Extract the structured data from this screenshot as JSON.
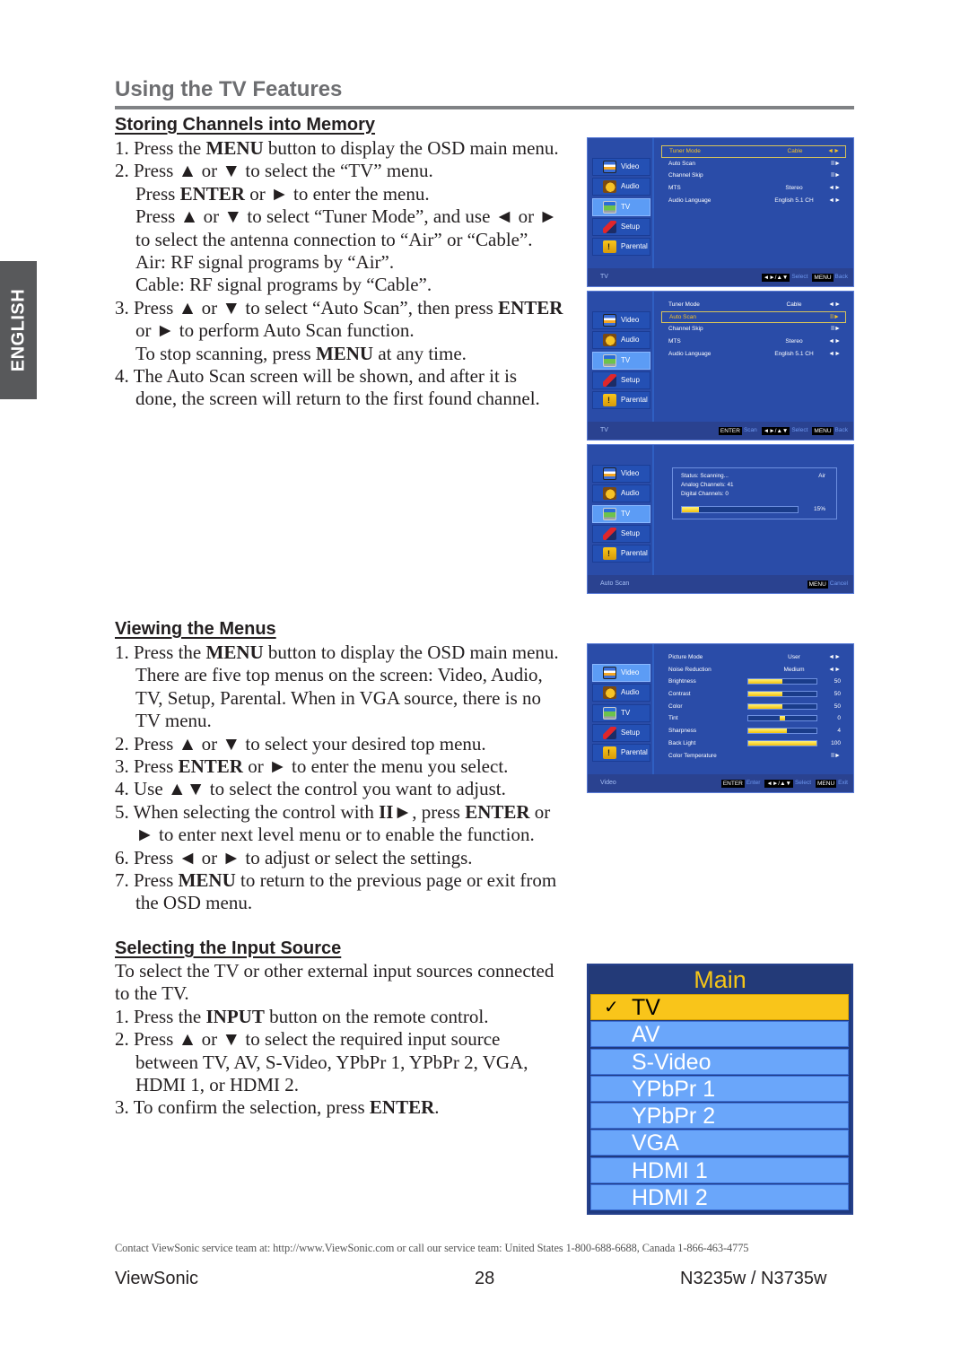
{
  "side_tab": "ENGLISH",
  "page_title": "Using the TV Features",
  "sections": {
    "storing": {
      "heading": "Storing Channels into Memory",
      "lines": [
        {
          "parts": [
            {
              "t": "1. Press the "
            },
            {
              "t": "MENU",
              "b": true
            },
            {
              "t": " button to display the OSD main menu."
            }
          ],
          "indent": false
        },
        {
          "parts": [
            {
              "t": "2. Press ▲ or ▼ to select the “TV” menu."
            }
          ],
          "indent": false
        },
        {
          "parts": [
            {
              "t": "Press "
            },
            {
              "t": "ENTER",
              "b": true
            },
            {
              "t": " or ► to enter the menu."
            }
          ],
          "indent": true
        },
        {
          "parts": [
            {
              "t": "Press ▲ or ▼ to select “Tuner Mode”, and use ◄ or ►"
            }
          ],
          "indent": true
        },
        {
          "parts": [
            {
              "t": "to select the antenna connection to “Air” or “Cable”."
            }
          ],
          "indent": true
        },
        {
          "parts": [
            {
              "t": "Air: RF signal programs by “Air”."
            }
          ],
          "indent": true
        },
        {
          "parts": [
            {
              "t": "Cable: RF signal programs by “Cable”."
            }
          ],
          "indent": true
        },
        {
          "parts": [
            {
              "t": "3. Press ▲ or ▼ to select “Auto Scan”, then press "
            },
            {
              "t": "ENTER",
              "b": true
            }
          ],
          "indent": false
        },
        {
          "parts": [
            {
              "t": "or ► to perform Auto Scan function."
            }
          ],
          "indent": true
        },
        {
          "parts": [
            {
              "t": "To stop scanning, press "
            },
            {
              "t": "MENU",
              "b": true
            },
            {
              "t": " at any time."
            }
          ],
          "indent": true
        },
        {
          "parts": [
            {
              "t": "4. The Auto Scan screen will be shown, and after it is"
            }
          ],
          "indent": false
        },
        {
          "parts": [
            {
              "t": "done, the screen will return to the first found channel."
            }
          ],
          "indent": true
        }
      ]
    },
    "viewing": {
      "heading": "Viewing the Menus",
      "lines": [
        {
          "parts": [
            {
              "t": "1. Press the "
            },
            {
              "t": "MENU",
              "b": true
            },
            {
              "t": " button to display the OSD main menu."
            }
          ],
          "indent": false
        },
        {
          "parts": [
            {
              "t": "There are five top menus on the screen: Video, Audio,"
            }
          ],
          "indent": true
        },
        {
          "parts": [
            {
              "t": "TV, Setup, Parental. When in VGA source, there is no"
            }
          ],
          "indent": true
        },
        {
          "parts": [
            {
              "t": "TV menu."
            }
          ],
          "indent": true
        },
        {
          "parts": [
            {
              "t": "2. Press ▲ or ▼ to select your desired top menu."
            }
          ],
          "indent": false
        },
        {
          "parts": [
            {
              "t": "3. Press "
            },
            {
              "t": "ENTER",
              "b": true
            },
            {
              "t": " or ► to enter the menu you select."
            }
          ],
          "indent": false
        },
        {
          "parts": [
            {
              "t": "4. Use ▲▼ to select the control you want to adjust."
            }
          ],
          "indent": false
        },
        {
          "parts": [
            {
              "t": "5. When selecting the control with "
            },
            {
              "t": "II►",
              "b": true
            },
            {
              "t": ", press "
            },
            {
              "t": "ENTER",
              "b": true
            },
            {
              "t": " or"
            }
          ],
          "indent": false
        },
        {
          "parts": [
            {
              "t": "► to enter next level menu or to enable the function."
            }
          ],
          "indent": true
        },
        {
          "parts": [
            {
              "t": "6. Press ◄ or ► to adjust or select the settings."
            }
          ],
          "indent": false
        },
        {
          "parts": [
            {
              "t": "7. Press "
            },
            {
              "t": "MENU",
              "b": true
            },
            {
              "t": " to return to the previous page or exit from"
            }
          ],
          "indent": false
        },
        {
          "parts": [
            {
              "t": "the OSD menu."
            }
          ],
          "indent": true
        }
      ]
    },
    "input": {
      "heading": "Selecting the Input Source",
      "lines": [
        {
          "parts": [
            {
              "t": "To select the TV or other external input sources connected"
            }
          ],
          "indent": false
        },
        {
          "parts": [
            {
              "t": "to the TV."
            }
          ],
          "indent": false
        },
        {
          "parts": [
            {
              "t": "1. Press the "
            },
            {
              "t": "INPUT",
              "b": true
            },
            {
              "t": " button on the remote control."
            }
          ],
          "indent": false
        },
        {
          "parts": [
            {
              "t": "2. Press ▲ or ▼ to select the required input source"
            }
          ],
          "indent": false
        },
        {
          "parts": [
            {
              "t": "between TV, AV, S-Video, YPbPr 1, YPbPr 2, VGA,"
            }
          ],
          "indent": true
        },
        {
          "parts": [
            {
              "t": "HDMI 1, or HDMI 2."
            }
          ],
          "indent": true
        },
        {
          "parts": [
            {
              "t": "3. To confirm the selection, press "
            },
            {
              "t": "ENTER",
              "b": true
            },
            {
              "t": "."
            }
          ],
          "indent": false
        }
      ]
    }
  },
  "osd_nav": [
    {
      "label": "Video",
      "icon": "video-icon"
    },
    {
      "label": "Audio",
      "icon": "audio-icon"
    },
    {
      "label": "TV",
      "icon": "tv-icon"
    },
    {
      "label": "Setup",
      "icon": "setup-icon"
    },
    {
      "label": "Parental",
      "icon": "parental-icon"
    }
  ],
  "osd_screens": {
    "tuner": {
      "active_nav": "TV",
      "rows": [
        {
          "label": "Tuner Mode",
          "value": "Cable",
          "arrow": "◄►",
          "selected": true
        },
        {
          "label": "Auto Scan",
          "value": "",
          "arrow": "II►",
          "selected": false
        },
        {
          "label": "Channel Skip",
          "value": "",
          "arrow": "II►",
          "selected": false
        },
        {
          "label": "MTS",
          "value": "Stereo",
          "arrow": "◄►",
          "selected": false
        },
        {
          "label": "Audio Language",
          "value": "English 5.1 CH",
          "arrow": "◄►",
          "selected": false
        }
      ],
      "footer_title": "TV",
      "hints": [
        {
          "key": "◄►/▲▼",
          "label": "Select"
        },
        {
          "key": "MENU",
          "label": "Back"
        }
      ]
    },
    "autoscan_select": {
      "active_nav": "TV",
      "rows": [
        {
          "label": "Tuner Mode",
          "value": "Cable",
          "arrow": "◄►",
          "selected": false
        },
        {
          "label": "Auto Scan",
          "value": "",
          "arrow": "II►",
          "selected": true
        },
        {
          "label": "Channel Skip",
          "value": "",
          "arrow": "II►",
          "selected": false
        },
        {
          "label": "MTS",
          "value": "Stereo",
          "arrow": "◄►",
          "selected": false
        },
        {
          "label": "Audio Language",
          "value": "English 5.1 CH",
          "arrow": "◄►",
          "selected": false
        }
      ],
      "footer_title": "TV",
      "hints": [
        {
          "key": "ENTER",
          "label": "Scan"
        },
        {
          "key": "◄►/▲▼",
          "label": "Select"
        },
        {
          "key": "MENU",
          "label": "Back"
        }
      ]
    },
    "scanning": {
      "active_nav": "TV",
      "status": "Status: Scanning...",
      "mode": "Air",
      "analog": "Analog Channels: 41",
      "digital": "Digital Channels: 0",
      "progress_percent": 15,
      "progress_label": "15%",
      "footer_title": "Auto Scan",
      "hints": [
        {
          "key": "MENU",
          "label": "Cancel"
        }
      ]
    },
    "video": {
      "active_nav": "Video",
      "rows": [
        {
          "label": "Picture Mode",
          "value": "User",
          "arrow": "◄►"
        },
        {
          "label": "Noise Reduction",
          "value": "Medium",
          "arrow": "◄►"
        },
        {
          "label": "Brightness",
          "slider": 50,
          "num": "50"
        },
        {
          "label": "Contrast",
          "slider": 50,
          "num": "50"
        },
        {
          "label": "Color",
          "slider": 50,
          "num": "50"
        },
        {
          "label": "Tint",
          "tint": 0,
          "num": "0"
        },
        {
          "label": "Sharpness",
          "slider": 56,
          "num": "4"
        },
        {
          "label": "Back Light",
          "slider": 100,
          "num": "100"
        },
        {
          "label": "Color Temperature",
          "value": "",
          "arrow": "II►"
        }
      ],
      "footer_title": "Video",
      "hints": [
        {
          "key": "ENTER",
          "label": "Enter"
        },
        {
          "key": "◄►/▲▼",
          "label": "Select"
        },
        {
          "key": "MENU",
          "label": "Exit"
        }
      ]
    }
  },
  "input_menu": {
    "title": "Main",
    "check": "✓",
    "items": [
      "TV",
      "AV",
      "S-Video",
      "YPbPr 1",
      "YPbPr 2",
      "VGA",
      "HDMI 1",
      "HDMI 2"
    ],
    "selected": "TV"
  },
  "contact": "Contact ViewSonic service team at: http://www.ViewSonic.com or call our service team: United States 1-800-688-6688, Canada 1-866-463-4775",
  "footer": {
    "brand": "ViewSonic",
    "page": "28",
    "model": "N3235w / N3735w"
  }
}
